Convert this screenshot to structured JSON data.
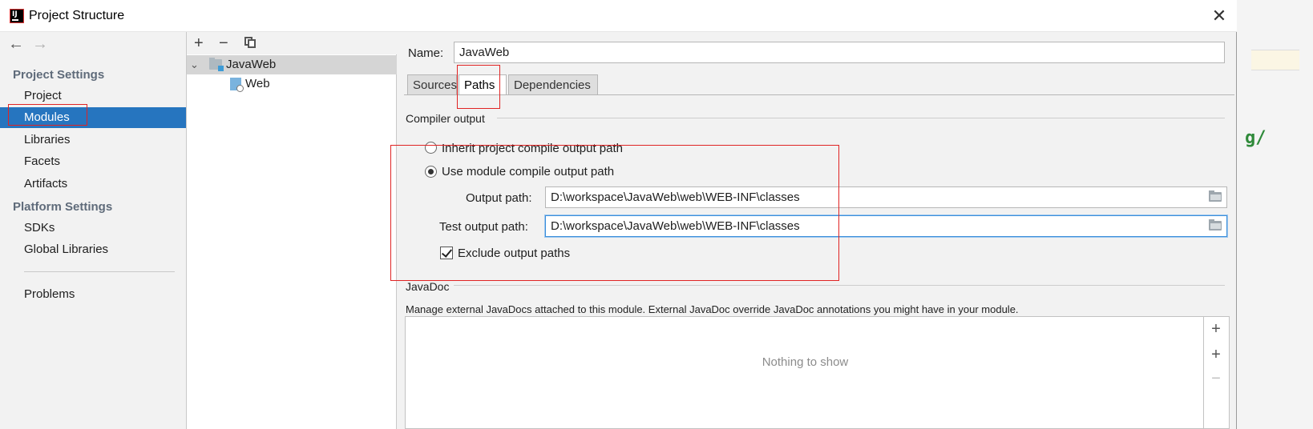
{
  "window": {
    "title": "Project Structure",
    "close_glyph": "✕"
  },
  "background": {
    "code_fragment": "g/"
  },
  "nav": {
    "back_glyph": "←",
    "forward_glyph": "→",
    "project_settings_heading": "Project Settings",
    "project_settings": [
      {
        "label": "Project"
      },
      {
        "label": "Modules",
        "selected": true
      },
      {
        "label": "Libraries"
      },
      {
        "label": "Facets"
      },
      {
        "label": "Artifacts"
      }
    ],
    "platform_settings_heading": "Platform Settings",
    "platform_settings": [
      {
        "label": "SDKs"
      },
      {
        "label": "Global Libraries"
      }
    ],
    "problems_label": "Problems"
  },
  "tree": {
    "toolbar": {
      "add_glyph": "+",
      "remove_glyph": "−"
    },
    "nodes": [
      {
        "label": "JavaWeb",
        "expanded": true,
        "selected": true,
        "icon": "module-folder-icon"
      },
      {
        "label": "Web",
        "icon": "web-facet-icon"
      }
    ]
  },
  "module": {
    "name_label": "Name:",
    "name_value": "JavaWeb",
    "tabs": [
      {
        "label": "Sources"
      },
      {
        "label": "Paths",
        "active": true
      },
      {
        "label": "Dependencies"
      }
    ],
    "compiler_output": {
      "heading": "Compiler output",
      "inherit_label": "Inherit project compile output path",
      "inherit_checked": false,
      "use_module_label": "Use module compile output path",
      "use_module_checked": true,
      "output_path_label": "Output path:",
      "output_path_value": "D:\\workspace\\JavaWeb\\web\\WEB-INF\\classes",
      "test_output_path_label": "Test output path:",
      "test_output_path_value": "D:\\workspace\\JavaWeb\\web\\WEB-INF\\classes",
      "exclude_label": "Exclude output paths",
      "exclude_checked": true
    },
    "javadoc": {
      "heading": "JavaDoc",
      "description": "Manage external JavaDocs attached to this module. External JavaDoc override JavaDoc annotations you might have in your module.",
      "empty_text": "Nothing to show",
      "add_glyph": "+",
      "add_url_glyph": "+",
      "remove_glyph": "−"
    }
  },
  "colors": {
    "selection": "#2675bf",
    "annotation": "#e02424",
    "focus": "#3c8fdb"
  }
}
